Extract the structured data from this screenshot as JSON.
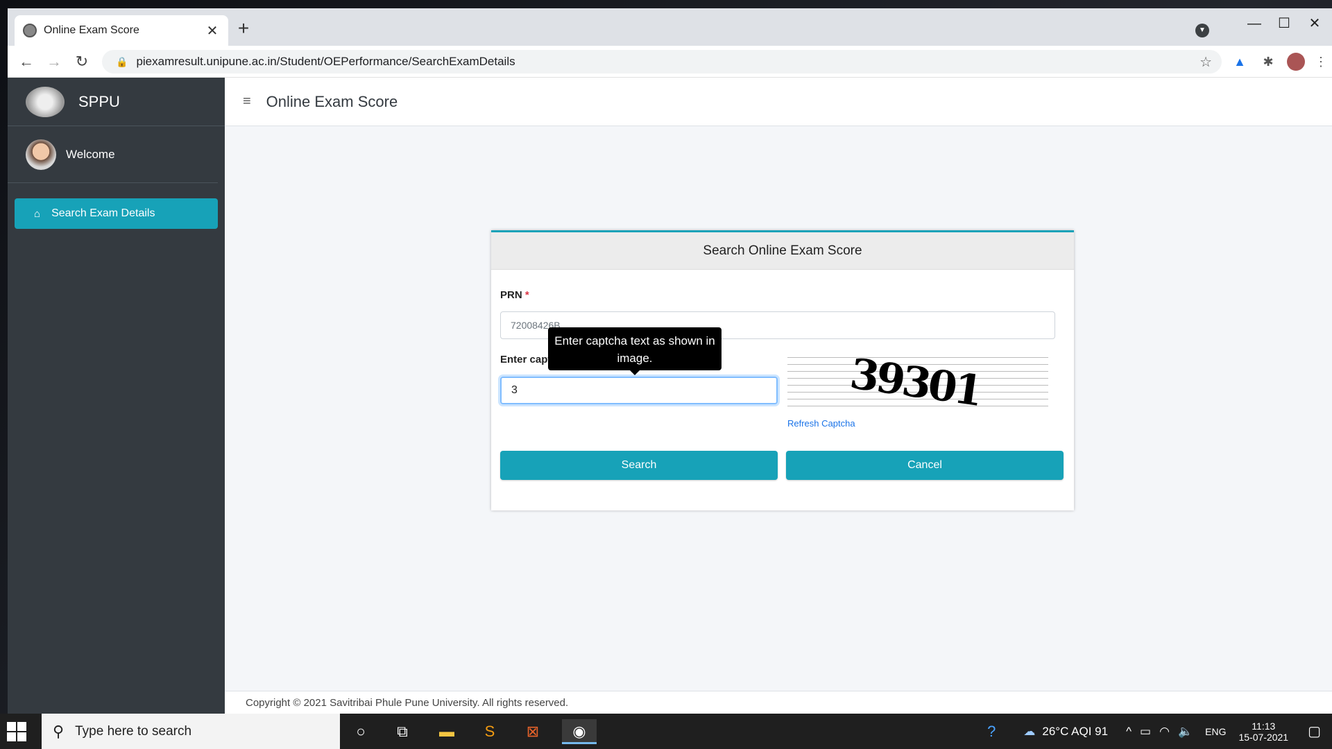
{
  "browser": {
    "tab_title": "Online Exam Score",
    "tab_close": "✕",
    "new_tab": "+",
    "url": "piexamresult.unipune.ac.in/Student/OEPerformance/SearchExamDetails",
    "window_controls": {
      "minimize": "—",
      "maximize": "☐",
      "close": "✕"
    }
  },
  "sidebar": {
    "brand": "SPPU",
    "user_greeting": "Welcome",
    "items": [
      {
        "label": "Search Exam Details",
        "icon": "home-icon",
        "active": true
      }
    ]
  },
  "header": {
    "title": "Online Exam Score",
    "menu_icon": "≡"
  },
  "form": {
    "title": "Search Online Exam Score",
    "prn_label": "PRN",
    "prn_value": "72008426B",
    "captcha_label": "Enter captcha text as shown in image",
    "required_mark": "*",
    "captcha_value": "3",
    "captcha_image_text": "39301",
    "refresh_label": "Refresh Captcha",
    "search_label": "Search",
    "cancel_label": "Cancel",
    "tooltip": "Enter captcha text as shown in image."
  },
  "footer": {
    "copyright": "Copyright © 2021 Savitribai Phule Pune University. All rights reserved."
  },
  "taskbar": {
    "search_placeholder": "Type here to search",
    "weather": "26°C  AQI 91",
    "language": "ENG",
    "time": "11:13",
    "date": "15-07-2021"
  },
  "colors": {
    "accent": "#17a2b8",
    "sidebar": "#343a40"
  }
}
